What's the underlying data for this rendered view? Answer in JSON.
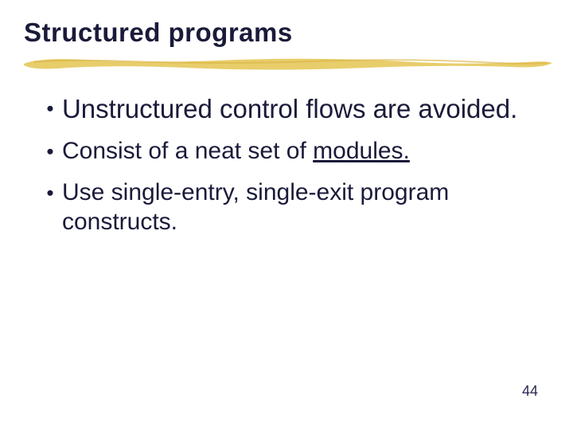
{
  "title": "Structured programs",
  "bullets": [
    {
      "size": "large",
      "pre": "Unstructured control flows are avoided.",
      "u": "",
      "post": ""
    },
    {
      "size": "med",
      "pre": "Consist of a neat set of ",
      "u": "modules.",
      "post": ""
    },
    {
      "size": "med",
      "pre": "Use single-entry, single-exit program constructs.",
      "u": "",
      "post": ""
    }
  ],
  "page_number": "44"
}
